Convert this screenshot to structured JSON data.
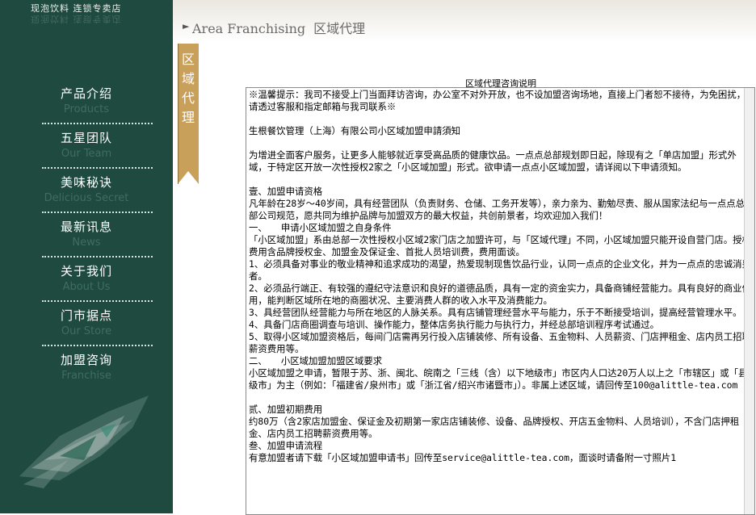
{
  "brand": {
    "slogan": "现泡饮料  连锁专卖店",
    "slogan_reflection": "现泡饮料  连锁专卖店"
  },
  "nav": [
    {
      "zh": "产品介绍",
      "en": "Products"
    },
    {
      "zh": "五星团队",
      "en": "Our Team"
    },
    {
      "zh": "美味秘诀",
      "en": "Delicious Secret"
    },
    {
      "zh": "最新讯息",
      "en": "News"
    },
    {
      "zh": "关于我们",
      "en": "About Us"
    },
    {
      "zh": "门市据点",
      "en": "Our Store"
    },
    {
      "zh": "加盟咨询",
      "en": "Franchise"
    }
  ],
  "header": {
    "arrow_icon": "triangle-right-icon",
    "title_en": "Area Franchising",
    "title_zh": "区域代理"
  },
  "ribbon": {
    "label": "区\n域\n代\n理",
    "color": "#c9a05a"
  },
  "document": {
    "heading": "区域代理咨询说明",
    "text": "※温馨提示：我司不接受上门当面拜访咨询，办公室不对外开放，也不设加盟咨询场地，直接上门者恕不接待，为免困扰，请透过客服和指定邮箱与我司联系※\n\n生根餐饮管理（上海）有限公司小区域加盟申請須知\n\n为增进全面客户服务，让更多人能够就近享受高品质的健康饮品。一点点总部规划即日起，除现有之「单店加盟」形式外域，于特定区开放一次性授权2家之「小区域加盟」形式。欲申请一点点小区域加盟，请详阅以下申请须知。\n\n壹、加盟申请资格\n凡年龄在28岁～40岁间，具有经营团队（负责财务、仓储、工务开发等），亲力亲为、勤勉尽责、服从国家法纪与一点点总部公司规范，愿共同为维护品牌与加盟双方的最大权益，共创前景者，均欢迎加入我们！\n一、　　申请小区域加盟之自身条件\n「小区域加盟」系由总部一次性授权小区域2家门店之加盟许可，与「区域代理」不同，小区域加盟只能开设自营门店。授权费用含品牌授权金、加盟金及保证金、首批人员培训费，费用面谈。\n1、必须具备对事业的敬业精神和追求成功的渴望，热爱现制现售饮品行业，认同一点点的企业文化，并为一点点的忠诚消费者。\n2、必须品行端正、有较强的遵纪守法意识和良好的道德品质，具有一定的资金实力，具备商铺经营能力。具有良好的商业信用，能判断区域所在地的商圈状况、主要消费人群的收入水平及消费能力。\n3、具经营团队经营能力与所在地区的人脉关系。具有店铺管理经营水平与能力，乐于不断接受培训，提高经营管理水平。\n4、具备门店商圈调查与培训、操作能力，整体店务执行能力与执行力，并经总部培训程序考试通过。\n5、取得小区域加盟资格后，每间门店需再另行投入店铺装修、所有设备、五金物料、人员薪资、门店押租金、店内员工招聘薪资费用等。\n二、　　小区域加盟加盟区域要求\n小区域加盟之申请，暂限于苏、浙、闽北、皖南之「三线（含）以下地级市」市区内人口达20万人以上之「市辖区」或「县级市」为主（例如：「福建省/泉州市」或「浙江省/绍兴市诸暨市」）。非属上述区域，请回传至100@alittle-tea.com\n\n贰、加盟初期费用\n约80万（含2家店加盟金、保证金及初期第一家店店铺装修、设备、品牌授权、开店五金物料、人员培训），不含门店押租金、店内员工招聘薪资费用等。\n叁、加盟申请流程\n有意加盟者请下载「小区域加盟申请书」回传至service@alittle-tea.com，面谈时请备附一寸照片1"
  },
  "colors": {
    "sidebar": "#1e4a3f",
    "nav_en": "#3f6e61",
    "ribbon": "#c9a05a"
  }
}
